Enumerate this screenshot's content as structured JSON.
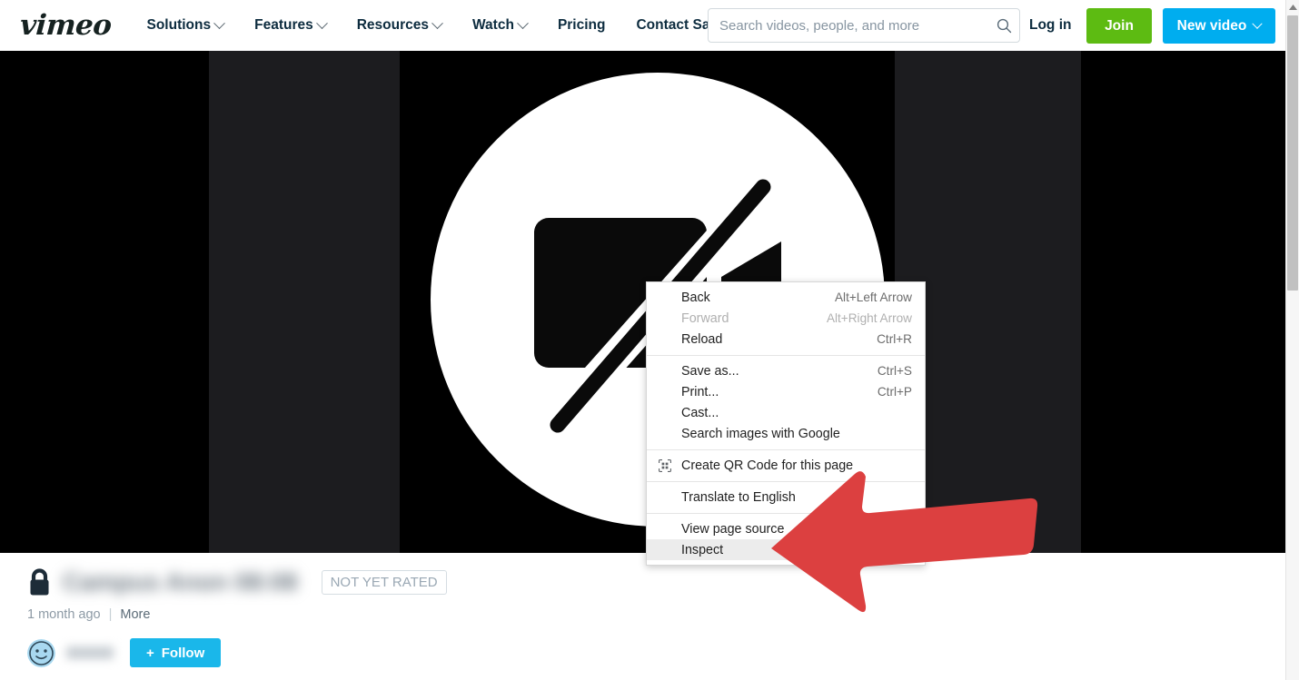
{
  "header": {
    "logo": "vimeo",
    "nav": [
      {
        "label": "Solutions",
        "has_caret": true
      },
      {
        "label": "Features",
        "has_caret": true
      },
      {
        "label": "Resources",
        "has_caret": true
      },
      {
        "label": "Watch",
        "has_caret": true
      },
      {
        "label": "Pricing",
        "has_caret": false
      },
      {
        "label": "Contact Sales",
        "has_caret": false
      }
    ],
    "search": {
      "placeholder": "Search videos, people, and more",
      "value": "",
      "icon": "search-icon"
    },
    "login_label": "Log in",
    "join_label": "Join",
    "new_video_label": "New video",
    "colors": {
      "join_green": "#5DBB12",
      "new_video_blue": "#00ADEF",
      "nav_text": "#0d2c3f"
    }
  },
  "player": {
    "state_icon": "video-unavailable-icon",
    "background": "#000000",
    "band_color": "#1c1c1f"
  },
  "video_meta": {
    "privacy_icon": "lock-icon",
    "title": "",
    "title_redacted": true,
    "rating_badge": "NOT YET RATED",
    "upload_time": "1 month ago",
    "separator": "|",
    "more_label": "More",
    "owner": {
      "avatar_icon": "smiley-avatar-icon",
      "name": "",
      "name_redacted": true,
      "follow_label": "Follow",
      "follow_plus": "+",
      "follow_color": "#1AB7EA"
    }
  },
  "context_menu": {
    "groups": [
      {
        "items": [
          {
            "label": "Back",
            "accel": "Alt+Left Arrow",
            "disabled": false,
            "highlight": false,
            "icon": null
          },
          {
            "label": "Forward",
            "accel": "Alt+Right Arrow",
            "disabled": true,
            "highlight": false,
            "icon": null
          },
          {
            "label": "Reload",
            "accel": "Ctrl+R",
            "disabled": false,
            "highlight": false,
            "icon": null
          }
        ]
      },
      {
        "items": [
          {
            "label": "Save as...",
            "accel": "Ctrl+S",
            "disabled": false,
            "highlight": false,
            "icon": null
          },
          {
            "label": "Print...",
            "accel": "Ctrl+P",
            "disabled": false,
            "highlight": false,
            "icon": null
          },
          {
            "label": "Cast...",
            "accel": "",
            "disabled": false,
            "highlight": false,
            "icon": null
          },
          {
            "label": "Search images with Google",
            "accel": "",
            "disabled": false,
            "highlight": false,
            "icon": null
          }
        ]
      },
      {
        "items": [
          {
            "label": "Create QR Code for this page",
            "accel": "",
            "disabled": false,
            "highlight": false,
            "icon": "qr-code-icon"
          }
        ]
      },
      {
        "items": [
          {
            "label": "Translate to English",
            "accel": "",
            "disabled": false,
            "highlight": false,
            "icon": null
          }
        ]
      },
      {
        "items": [
          {
            "label": "View page source",
            "accel": "",
            "disabled": false,
            "highlight": false,
            "icon": null
          },
          {
            "label": "Inspect",
            "accel": "",
            "disabled": false,
            "highlight": true,
            "icon": null
          }
        ]
      }
    ],
    "highlight_color": "#ececec"
  },
  "annotation": {
    "shape": "left-pointing-arrow",
    "color": "#DC4040",
    "points_at": "Inspect"
  },
  "scrollbar": {
    "up_arrow_icon": "scroll-up-arrow-icon",
    "thumb_color": "#c1c1c1",
    "track_color": "#f6f6f6"
  }
}
